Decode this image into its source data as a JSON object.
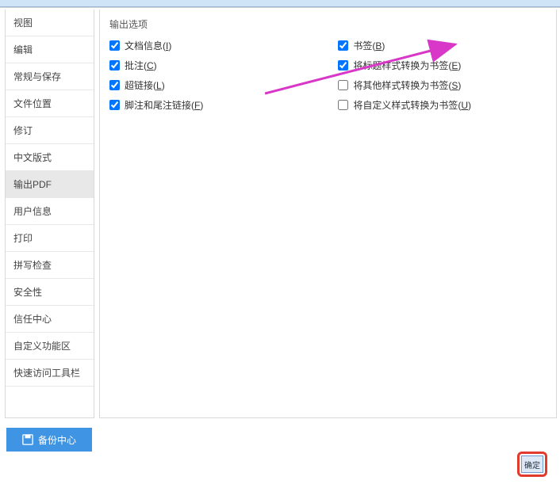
{
  "sidebar": {
    "items": [
      {
        "label": "视图"
      },
      {
        "label": "编辑"
      },
      {
        "label": "常规与保存"
      },
      {
        "label": "文件位置"
      },
      {
        "label": "修订"
      },
      {
        "label": "中文版式"
      },
      {
        "label": "输出PDF"
      },
      {
        "label": "用户信息"
      },
      {
        "label": "打印"
      },
      {
        "label": "拼写检查"
      },
      {
        "label": "安全性"
      },
      {
        "label": "信任中心"
      },
      {
        "label": "自定义功能区"
      },
      {
        "label": "快速访问工具栏"
      }
    ],
    "selected_index": 6
  },
  "main": {
    "section_title": "输出选项",
    "left_options": [
      {
        "label": "文档信息",
        "mnemonic": "I",
        "checked": true
      },
      {
        "label": "批注",
        "mnemonic": "C",
        "checked": true
      },
      {
        "label": "超链接",
        "mnemonic": "L",
        "checked": true
      },
      {
        "label": "脚注和尾注链接",
        "mnemonic": "F",
        "checked": true
      }
    ],
    "right_options": [
      {
        "label": "书签",
        "mnemonic": "B",
        "checked": true
      },
      {
        "label": "将标题样式转换为书签",
        "mnemonic": "E",
        "checked": true
      },
      {
        "label": "将其他样式转换为书签",
        "mnemonic": "S",
        "checked": false
      },
      {
        "label": "将自定义样式转换为书签",
        "mnemonic": "U",
        "checked": false
      }
    ]
  },
  "footer": {
    "backup_label": "备份中心",
    "ok_label": "确定"
  }
}
